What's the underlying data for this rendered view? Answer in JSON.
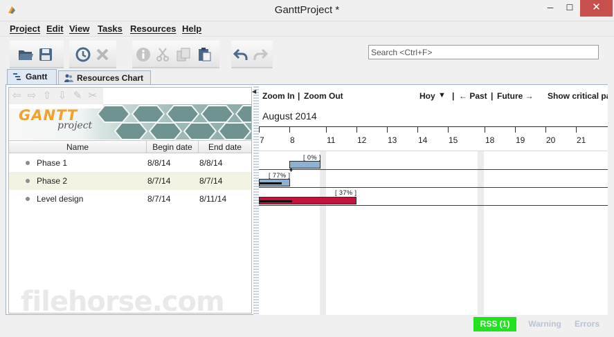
{
  "window": {
    "title": "GanttProject *",
    "minimize": "─",
    "maximize": "☐",
    "close": "✕"
  },
  "menu": [
    "Project",
    "Edit",
    "View",
    "Tasks",
    "Resources",
    "Help"
  ],
  "toolbar": {
    "buttons": [
      "open-icon",
      "save-icon",
      "history-icon",
      "delete-icon",
      "info-icon",
      "cut-icon",
      "copy-icon",
      "paste-icon",
      "undo-icon",
      "redo-icon"
    ],
    "search_placeholder": "Search <Ctrl+F>"
  },
  "tabs": [
    {
      "label": "Gantt",
      "icon": "gantt-tab-icon"
    },
    {
      "label": "Resources Chart",
      "icon": "resources-tab-icon"
    }
  ],
  "logo": {
    "title": "GANTT",
    "subtitle": "project"
  },
  "task_table": {
    "columns": [
      "Name",
      "Begin date",
      "End date"
    ],
    "rows": [
      {
        "name": "Phase 1",
        "begin": "8/8/14",
        "end": "8/8/14"
      },
      {
        "name": "Phase 2",
        "begin": "8/7/14",
        "end": "8/7/14"
      },
      {
        "name": "Level design",
        "begin": "8/7/14",
        "end": "8/11/14"
      }
    ]
  },
  "chart_toolbar": {
    "zoom_in": "Zoom In",
    "sep1": "|",
    "zoom_out": "Zoom Out",
    "today": "Hoy",
    "today_arrow": "▼",
    "sep2": "|",
    "past": "← Past",
    "sep3": "|",
    "future": "Future →",
    "critical": "Show critical pa"
  },
  "timeline": {
    "month": "August 2014",
    "days": [
      "7",
      "8",
      "11",
      "12",
      "13",
      "14",
      "15",
      "18",
      "19",
      "20",
      "21"
    ]
  },
  "gantt_bars": [
    {
      "task": "Phase 1",
      "start_day": "8",
      "progress_label": "[ 0% ]",
      "color": "#8fb0cf"
    },
    {
      "task": "Phase 2",
      "start_day": "7",
      "progress_label": "[ 77% ]",
      "color": "#8fb0cf"
    },
    {
      "task": "Level design",
      "start_day": "7",
      "end_day": "11",
      "progress_label": "[ 37% ]",
      "color": "#c0143c"
    }
  ],
  "status": {
    "rss": "RSS (1)",
    "warning": "Warning",
    "errors": "Errors"
  },
  "watermark": "filehorse.com",
  "colors": {
    "accent": "#9fb0c3",
    "rss_bg": "#22e31f",
    "task_bar": "#8fb0cf",
    "critical_bar": "#c0143c"
  }
}
